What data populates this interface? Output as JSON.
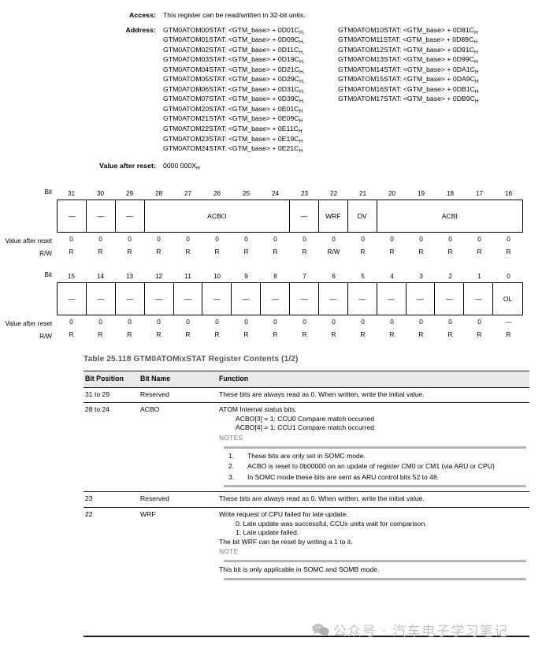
{
  "spec": {
    "access_label": "Access:",
    "access_value": "This register can be read/written in 32-bit units.",
    "address_label": "Address:",
    "addresses_left": [
      "GTM0ATOM00STAT: <GTM_base> + 0D01C",
      "GTM0ATOM01STAT: <GTM_base> + 0D09C",
      "GTM0ATOM02STAT: <GTM_base> + 0D11C",
      "GTM0ATOM03STAT: <GTM_base> + 0D19C",
      "GTM0ATOM04STAT: <GTM_base> + 0D21C",
      "GTM0ATOM05STAT: <GTM_base> + 0D29C",
      "GTM0ATOM06STAT: <GTM_base> + 0D31C",
      "GTM0ATOM07STAT: <GTM_base> + 0D39C",
      "GTM0ATOM20STAT: <GTM_base> + 0E01C",
      "GTM0ATOM21STAT: <GTM_base> + 0E09C",
      "GTM0ATOM22STAT: <GTM_base> + 0E11C",
      "GTM0ATOM23STAT: <GTM_base> + 0E19C",
      "GTM0ATOM24STAT: <GTM_base> + 0E21C"
    ],
    "addresses_left_suffix": [
      "H,",
      "H,",
      "H,",
      "H,",
      "H,",
      "H,",
      "H,",
      "H,",
      "H",
      "H",
      "H",
      "H",
      "H"
    ],
    "addresses_right": [
      "GTM0ATOM10STAT: <GTM_base> + 0D81C",
      "GTM0ATOM11STAT: <GTM_base> + 0D89C",
      "GTM0ATOM12STAT: <GTM_base> + 0D91C",
      "GTM0ATOM13STAT: <GTM_base> + 0D99C",
      "GTM0ATOM14STAT: <GTM_base> + 0DA1C",
      "GTM0ATOM15STAT: <GTM_base> + 0DA9C",
      "GTM0ATOM16STAT: <GTM_base> + 0DB1C",
      "GTM0ATOM17STAT: <GTM_base> + 0DB9C"
    ],
    "addresses_right_suffix": [
      "H",
      "H",
      "H",
      "H",
      "H",
      "H",
      "H",
      "H"
    ],
    "value_after_reset_label": "Value after reset:",
    "value_after_reset": "0000 000X",
    "value_after_reset_sub": "H"
  },
  "bitdiagram": {
    "bit_label": "Bit",
    "reset_label": "Value after reset",
    "rw_label": "R/W",
    "upper": {
      "bits": [
        "31",
        "30",
        "29",
        "28",
        "27",
        "26",
        "25",
        "24",
        "23",
        "22",
        "21",
        "20",
        "19",
        "18",
        "17",
        "16"
      ],
      "fields": [
        {
          "name": "—",
          "span": 1
        },
        {
          "name": "—",
          "span": 1
        },
        {
          "name": "—",
          "span": 1
        },
        {
          "name": "ACBO",
          "span": 5
        },
        {
          "name": "—",
          "span": 1
        },
        {
          "name": "WRF",
          "span": 1
        },
        {
          "name": "DV",
          "span": 1
        },
        {
          "name": "ACBI",
          "span": 5
        }
      ],
      "reset": [
        "0",
        "0",
        "0",
        "0",
        "0",
        "0",
        "0",
        "0",
        "0",
        "0",
        "0",
        "0",
        "0",
        "0",
        "0",
        "0"
      ],
      "rw": [
        "R",
        "R",
        "R",
        "R",
        "R",
        "R",
        "R",
        "R",
        "R",
        "R/W",
        "R",
        "R",
        "R",
        "R",
        "R",
        "R"
      ]
    },
    "lower": {
      "bits": [
        "15",
        "14",
        "13",
        "12",
        "11",
        "10",
        "9",
        "8",
        "7",
        "6",
        "5",
        "4",
        "3",
        "2",
        "1",
        "0"
      ],
      "fields": [
        {
          "name": "—",
          "span": 1
        },
        {
          "name": "—",
          "span": 1
        },
        {
          "name": "—",
          "span": 1
        },
        {
          "name": "—",
          "span": 1
        },
        {
          "name": "—",
          "span": 1
        },
        {
          "name": "—",
          "span": 1
        },
        {
          "name": "—",
          "span": 1
        },
        {
          "name": "—",
          "span": 1
        },
        {
          "name": "—",
          "span": 1
        },
        {
          "name": "—",
          "span": 1
        },
        {
          "name": "—",
          "span": 1
        },
        {
          "name": "—",
          "span": 1
        },
        {
          "name": "—",
          "span": 1
        },
        {
          "name": "—",
          "span": 1
        },
        {
          "name": "—",
          "span": 1
        },
        {
          "name": "OL",
          "span": 1
        }
      ],
      "reset": [
        "0",
        "0",
        "0",
        "0",
        "0",
        "0",
        "0",
        "0",
        "0",
        "0",
        "0",
        "0",
        "0",
        "0",
        "0",
        "—"
      ],
      "rw": [
        "R",
        "R",
        "R",
        "R",
        "R",
        "R",
        "R",
        "R",
        "R",
        "R",
        "R",
        "R",
        "R",
        "R",
        "R",
        "R"
      ]
    }
  },
  "table": {
    "caption": "Table 25.118   GTM0ATOMixSTAT Register Contents (1/2)",
    "headers": [
      "Bit Position",
      "Bit Name",
      "Function"
    ],
    "rows": [
      {
        "position": "31 to 29",
        "name": "Reserved",
        "function_lines": [
          "These bits are always read as 0. When written, write the initial value."
        ],
        "indented_lines": [],
        "notes_label": "",
        "notes": []
      },
      {
        "position": "28 to 24",
        "name": "ACBO",
        "function_lines": [
          "ATOM Internal status bits."
        ],
        "indented_lines": [
          "ACBO[3] = 1: CCU0 Compare match occurred",
          "ACBO[4] = 1: CCU1 Compare match occurred"
        ],
        "notes_label": "NOTES",
        "notes": [
          "These bits are only set in SOMC mode.",
          "ACBO is reset to 0b00000 on an update of register CM0 or CM1 (via ARU or CPU)",
          "In SOMC mode these bits are sent as ARU control bits 52 to 48."
        ]
      },
      {
        "position": "23",
        "name": "Reserved",
        "function_lines": [
          "These bits are always read as 0. When written, write the initial value."
        ],
        "indented_lines": [],
        "notes_label": "",
        "notes": []
      },
      {
        "position": "22",
        "name": "WRF",
        "function_lines": [
          "Write request of CPU failed for late update."
        ],
        "indented_lines": [
          "0: Late update was successful, CCUx units wait for comparison.",
          "1: Late update failed."
        ],
        "function_lines_after": [
          "The bit WRF can be reset by writing a 1 to it."
        ],
        "notes_label": "NOTE",
        "notes_plain": [
          "This bit is only applicable in SOMC and SOMB mode."
        ],
        "notes": []
      }
    ]
  },
  "watermark": {
    "text": "公众号 · 汽车电子学习笔记",
    "icon": "wechat-icon"
  }
}
